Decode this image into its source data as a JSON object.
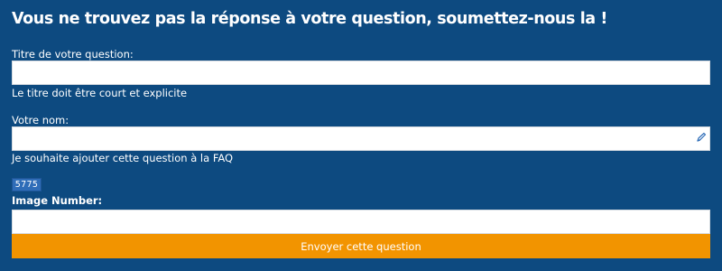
{
  "form": {
    "heading": "Vous ne trouvez pas la réponse à votre question, soumettez-nous la !",
    "title_field": {
      "label": "Titre de votre question:",
      "value": "",
      "help": "Le titre doit être court et explicite"
    },
    "name_field": {
      "label": "Votre nom:",
      "value": "",
      "help": "Je souhaite ajouter cette question à la FAQ"
    },
    "captcha": {
      "code": "5775",
      "label": "Image Number:",
      "value": ""
    },
    "submit_label": "Envoyer cette question"
  },
  "colors": {
    "background": "#0d4a80",
    "button": "#f29400",
    "captcha_bg": "#2f6db8"
  },
  "icons": {
    "name_field_icon": "pen-icon"
  }
}
